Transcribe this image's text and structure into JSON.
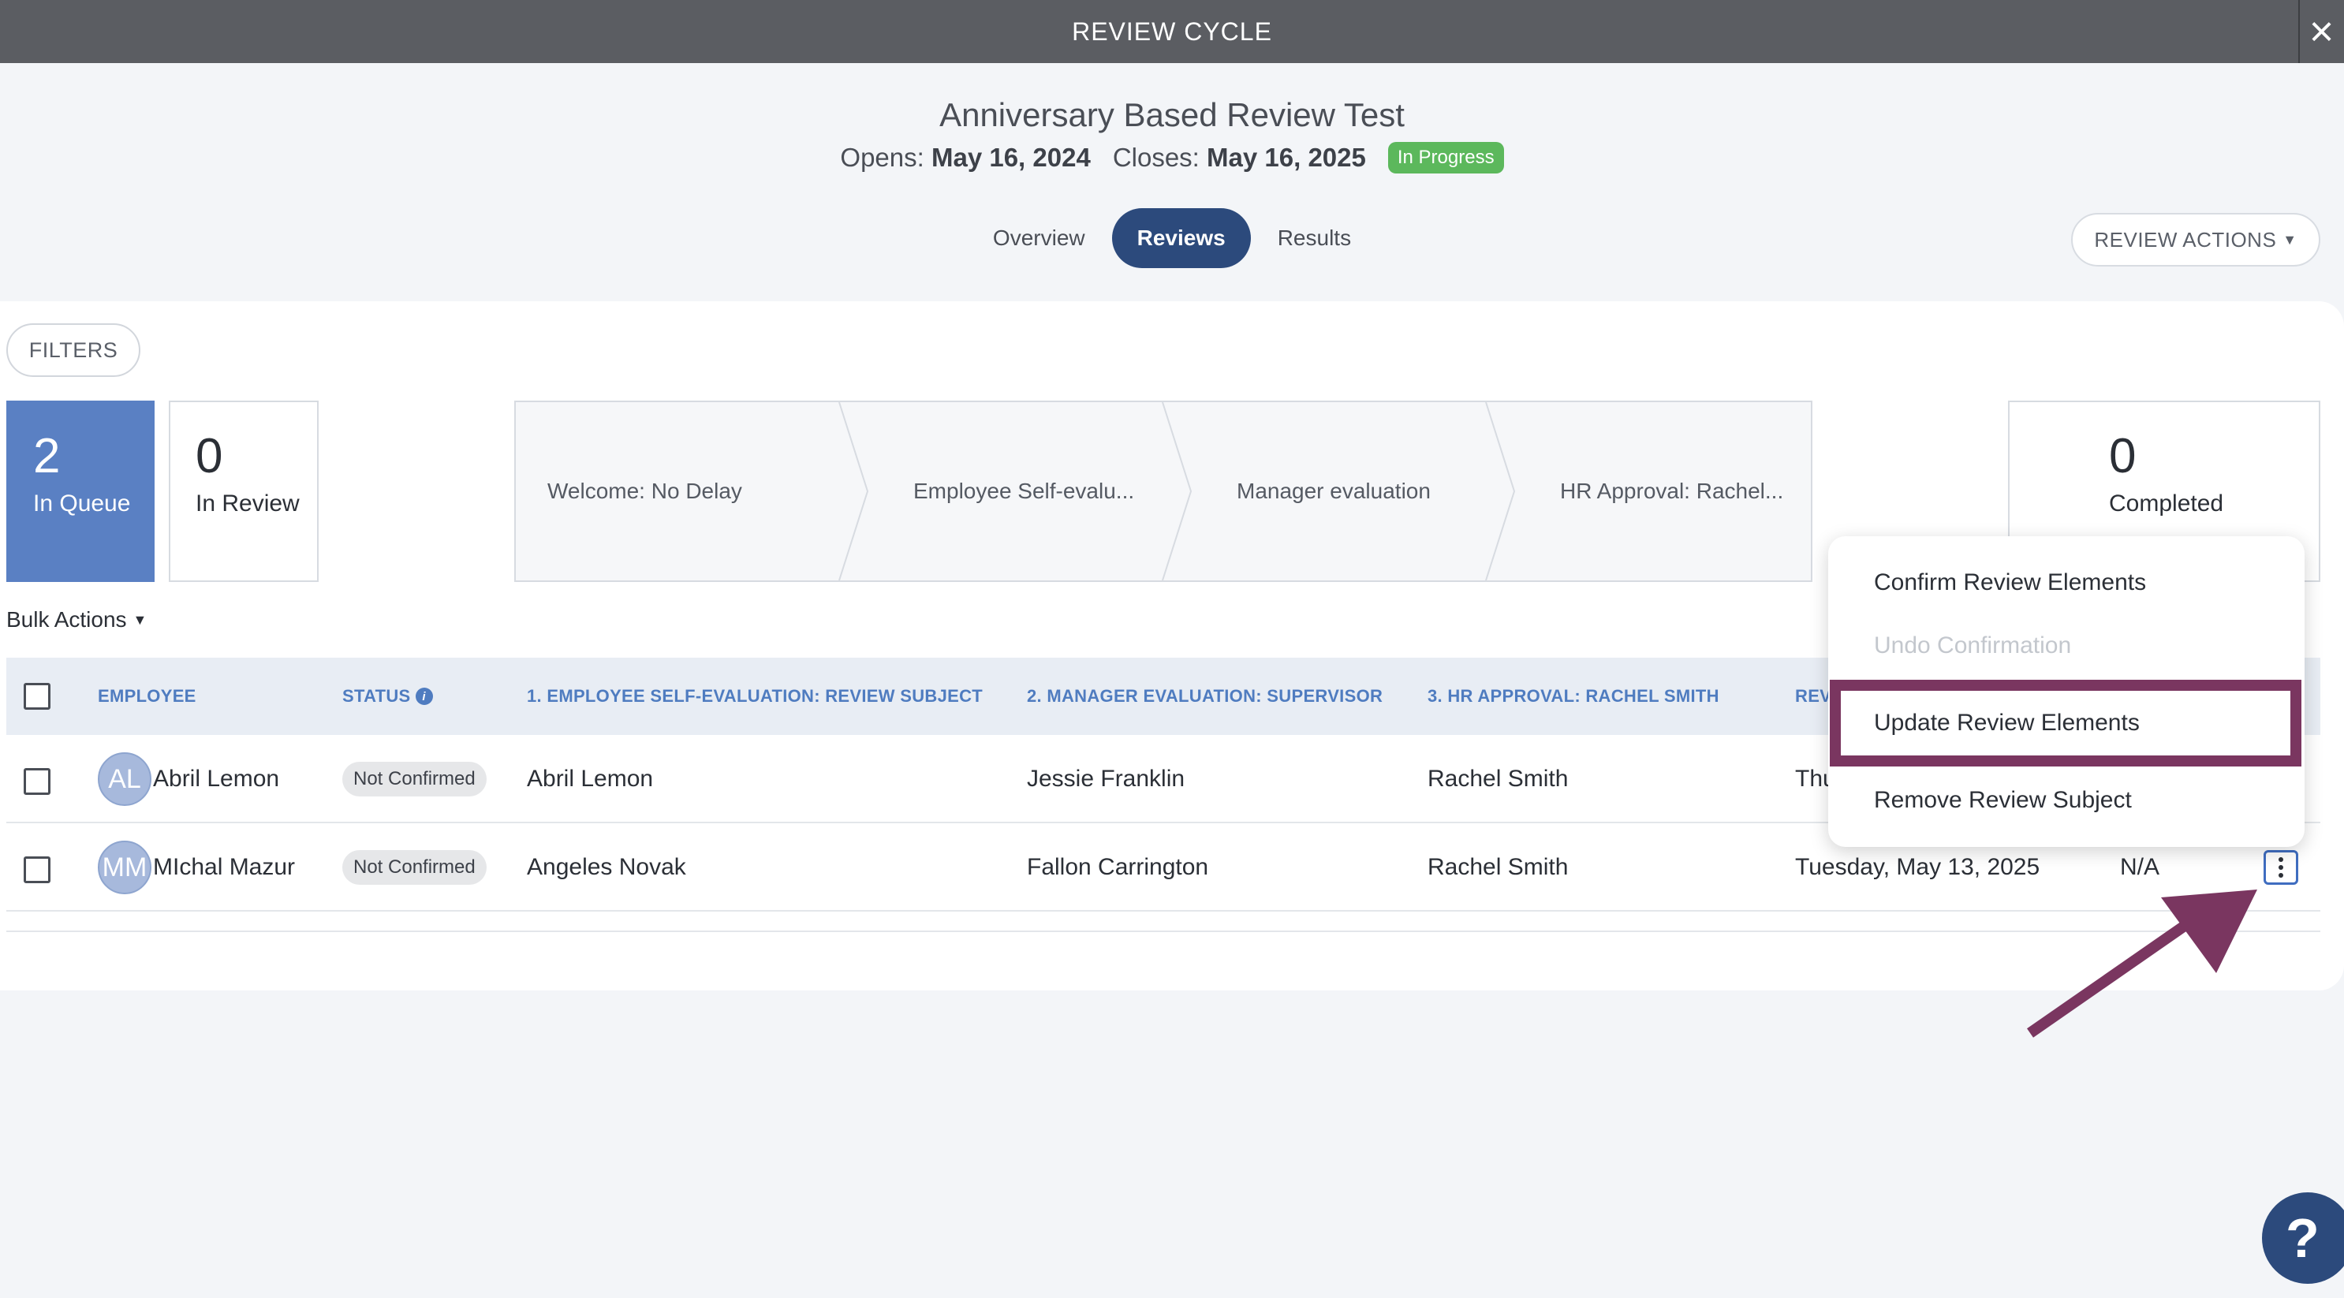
{
  "header": {
    "title": "REVIEW CYCLE",
    "close_icon": "×"
  },
  "cycle": {
    "name": "Anniversary Based Review Test",
    "opens_label": "Opens:",
    "opens_date": "May 16, 2024",
    "closes_label": "Closes:",
    "closes_date": "May 16, 2025",
    "status": "In Progress",
    "status_color": "#5cb85c"
  },
  "tabs": [
    {
      "label": "Overview",
      "active": false
    },
    {
      "label": "Reviews",
      "active": true
    },
    {
      "label": "Results",
      "active": false
    }
  ],
  "review_actions_label": "REVIEW ACTIONS",
  "filters_label": "FILTERS",
  "stats": {
    "queue": {
      "count": "2",
      "label": "In Queue"
    },
    "review": {
      "count": "0",
      "label": "In Review"
    },
    "completed": {
      "count": "0",
      "label": "Completed"
    }
  },
  "pipeline": [
    "Welcome: No Delay",
    "Employee Self-evalu...",
    "Manager evaluation",
    "HR Approval: Rachel..."
  ],
  "bulk_actions_label": "Bulk Actions",
  "table": {
    "columns": [
      "EMPLOYEE",
      "STATUS",
      "1. EMPLOYEE SELF-EVALUATION: REVIEW SUBJECT",
      "2. MANAGER EVALUATION: SUPERVISOR",
      "3. HR APPROVAL: RACHEL SMITH",
      "REV"
    ],
    "rows": [
      {
        "initials": "AL",
        "employee": "Abril Lemon",
        "status": "Not Confirmed",
        "self_eval": "Abril Lemon",
        "manager": "Jessie Franklin",
        "hr": "Rachel Smith",
        "date": "Thu",
        "extra": ""
      },
      {
        "initials": "MM",
        "employee": "MIchal Mazur",
        "status": "Not Confirmed",
        "self_eval": "Angeles Novak",
        "manager": "Fallon Carrington",
        "hr": "Rachel Smith",
        "date": "Tuesday, May 13, 2025",
        "extra": "N/A"
      }
    ]
  },
  "menu": {
    "items": [
      {
        "label": "Confirm Review Elements",
        "disabled": false
      },
      {
        "label": "Undo Confirmation",
        "disabled": true
      },
      {
        "label": "Update Review Elements",
        "disabled": false
      },
      {
        "label": "Remove Review Subject",
        "disabled": false
      }
    ]
  },
  "colors": {
    "accent": "#2c4a7c",
    "queue_tile": "#5a80c3",
    "highlight": "#7a3660",
    "header_text": "#4f7cc0"
  },
  "help_label": "?"
}
